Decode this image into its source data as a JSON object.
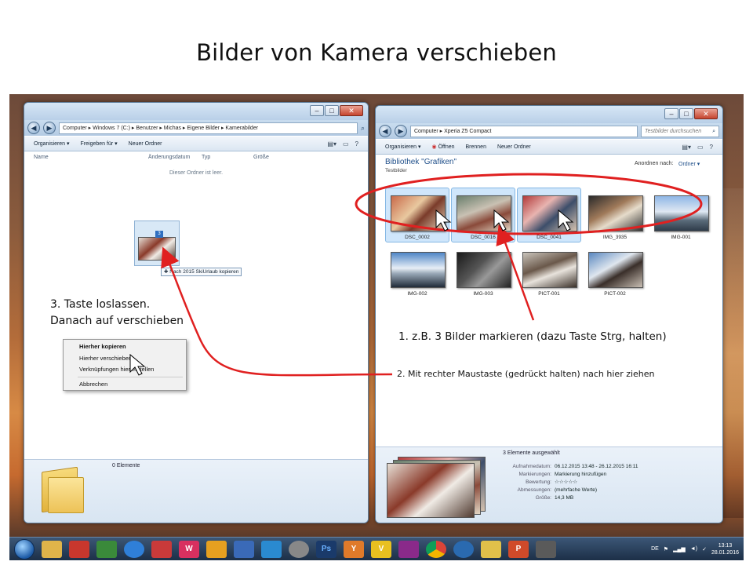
{
  "slide": {
    "title": "Bilder von Kamera verschieben"
  },
  "annotations": {
    "step1": "1. z.B. 3 Bilder markieren (dazu Taste Strg, halten)",
    "step2": "2. Mit rechter Maustaste (gedrückt halten) nach hier ziehen",
    "step3_line1": "3. Taste loslassen.",
    "step3_line2": "Danach auf verschieben",
    "arrow_color": "#e02020"
  },
  "left_window": {
    "address": "Computer ▸ Windows 7 (C:) ▸ Benutzer ▸ Michas ▸ Eigene Bilder ▸ Kamerabilder",
    "toolbar": {
      "organize": "Organisieren ▾",
      "share": "Freigeben für ▾",
      "new_folder": "Neuer Ordner"
    },
    "columns": [
      "Name",
      "Änderungsdatum",
      "Typ",
      "Größe"
    ],
    "empty_text": "Dieser Ordner ist leer.",
    "drag_count": "3",
    "drag_tooltip": "✚ Nach 2015 SkiUrlaub kopieren",
    "status_count": "0 Elemente"
  },
  "context_menu": {
    "items": [
      "Hierher kopieren",
      "Hierher verschieben",
      "Verknüpfungen hier erstellen",
      "Abbrechen"
    ]
  },
  "right_window": {
    "address": "Computer ▸ Xperia Z5 Compact",
    "search_placeholder": "Testbilder durchsuchen",
    "toolbar": {
      "organize": "Organisieren ▾",
      "open": "Öffnen",
      "burn": "Brennen",
      "new_folder": "Neuer Ordner"
    },
    "library_title": "Bibliothek \"Grafiken\"",
    "library_sub": "Testbilder",
    "arrange_label": "Anordnen nach:",
    "arrange_value": "Ordner ▾",
    "thumbnails": [
      {
        "label": "DSC_0002",
        "selected": true
      },
      {
        "label": "DSC_0016",
        "selected": true
      },
      {
        "label": "DSC_0041",
        "selected": true
      },
      {
        "label": "IMG_3935",
        "selected": false
      },
      {
        "label": "IMG-001",
        "selected": false
      },
      {
        "label": "IMG-002",
        "selected": false
      },
      {
        "label": "IMG-003",
        "selected": false
      },
      {
        "label": "PICT-001",
        "selected": false
      },
      {
        "label": "PICT-002",
        "selected": false
      }
    ],
    "details": {
      "count": "3 Elemente ausgewählt",
      "rows": [
        {
          "key": "Aufnahmedatum:",
          "value": "06.12.2015 13:48 - 26.12.2015 16:11"
        },
        {
          "key": "Markierungen:",
          "value": "Markierung hinzufügen"
        },
        {
          "key": "Bewertung:",
          "value": "☆☆☆☆☆"
        },
        {
          "key": "Abmessungen:",
          "value": "(mehrfache Werte)"
        },
        {
          "key": "Größe:",
          "value": "14,3 MB"
        }
      ]
    }
  },
  "taskbar": {
    "lang": "DE",
    "time": "13:13",
    "date": "28.01.2016"
  }
}
